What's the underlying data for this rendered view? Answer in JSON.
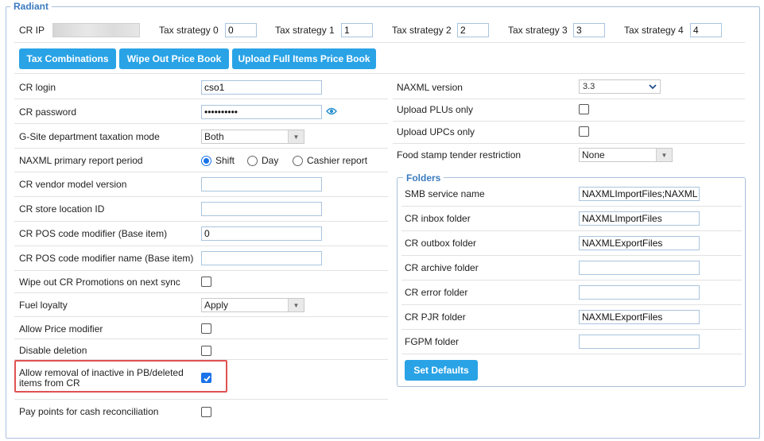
{
  "section": {
    "title": "Radiant"
  },
  "header": {
    "cr_ip_label": "CR IP",
    "cr_ip_value": "",
    "tax_strategies": [
      {
        "label": "Tax strategy 0",
        "value": "0"
      },
      {
        "label": "Tax strategy 1",
        "value": "1"
      },
      {
        "label": "Tax strategy 2",
        "value": "2"
      },
      {
        "label": "Tax strategy 3",
        "value": "3"
      },
      {
        "label": "Tax strategy 4",
        "value": "4"
      }
    ]
  },
  "buttons": {
    "tax_combinations": "Tax Combinations",
    "wipe_out_price_book": "Wipe Out Price Book",
    "upload_full_items": "Upload Full Items Price Book",
    "set_defaults": "Set Defaults"
  },
  "left": {
    "cr_login_label": "CR login",
    "cr_login_value": "cso1",
    "cr_password_label": "CR password",
    "cr_password_value": "••••••••••",
    "gsite_label": "G-Site department taxation mode",
    "gsite_value": "Both",
    "report_period_label": "NAXML primary report period",
    "report_options": [
      "Shift",
      "Day",
      "Cashier report"
    ],
    "report_selected": "Shift",
    "vendor_model_label": "CR vendor model version",
    "vendor_model_value": "",
    "store_location_label": "CR store location ID",
    "store_location_value": "",
    "pos_modifier_label": "CR POS code modifier (Base item)",
    "pos_modifier_value": "0",
    "pos_modifier_name_label": "CR POS code modifier name (Base item)",
    "pos_modifier_name_value": "",
    "wipe_promotions_label": "Wipe out CR Promotions on next sync",
    "wipe_promotions_checked": false,
    "fuel_loyalty_label": "Fuel loyalty",
    "fuel_loyalty_value": "Apply",
    "allow_price_modifier_label": "Allow Price modifier",
    "allow_price_modifier_checked": false,
    "disable_deletion_label": "Disable deletion",
    "disable_deletion_checked": false,
    "allow_removal_label_line1": "Allow removal of inactive in PB/deleted",
    "allow_removal_label_line2": "items from CR",
    "allow_removal_checked": true,
    "pay_points_label": "Pay points for cash reconciliation",
    "pay_points_checked": false
  },
  "right": {
    "naxml_version_label": "NAXML version",
    "naxml_version_value": "3.3",
    "upload_plus_label": "Upload PLUs only",
    "upload_plus_checked": false,
    "upload_upcs_label": "Upload UPCs only",
    "upload_upcs_checked": false,
    "food_stamp_label": "Food stamp tender restriction",
    "food_stamp_value": "None"
  },
  "folders": {
    "title": "Folders",
    "smb_label": "SMB service name",
    "smb_value": "NAXMLImportFiles;NAXML",
    "inbox_label": "CR inbox folder",
    "inbox_value": "NAXMLImportFiles",
    "outbox_label": "CR outbox folder",
    "outbox_value": "NAXMLExportFiles",
    "archive_label": "CR archive folder",
    "archive_value": "",
    "error_label": "CR error folder",
    "error_value": "",
    "pjr_label": "CR PJR folder",
    "pjr_value": "NAXMLExportFiles",
    "fgpm_label": "FGPM folder",
    "fgpm_value": ""
  },
  "colors": {
    "accent": "#29a3e6",
    "legend": "#3b7bbf",
    "highlight": "#e05252",
    "checkbox_checked": "#1a73e8"
  }
}
